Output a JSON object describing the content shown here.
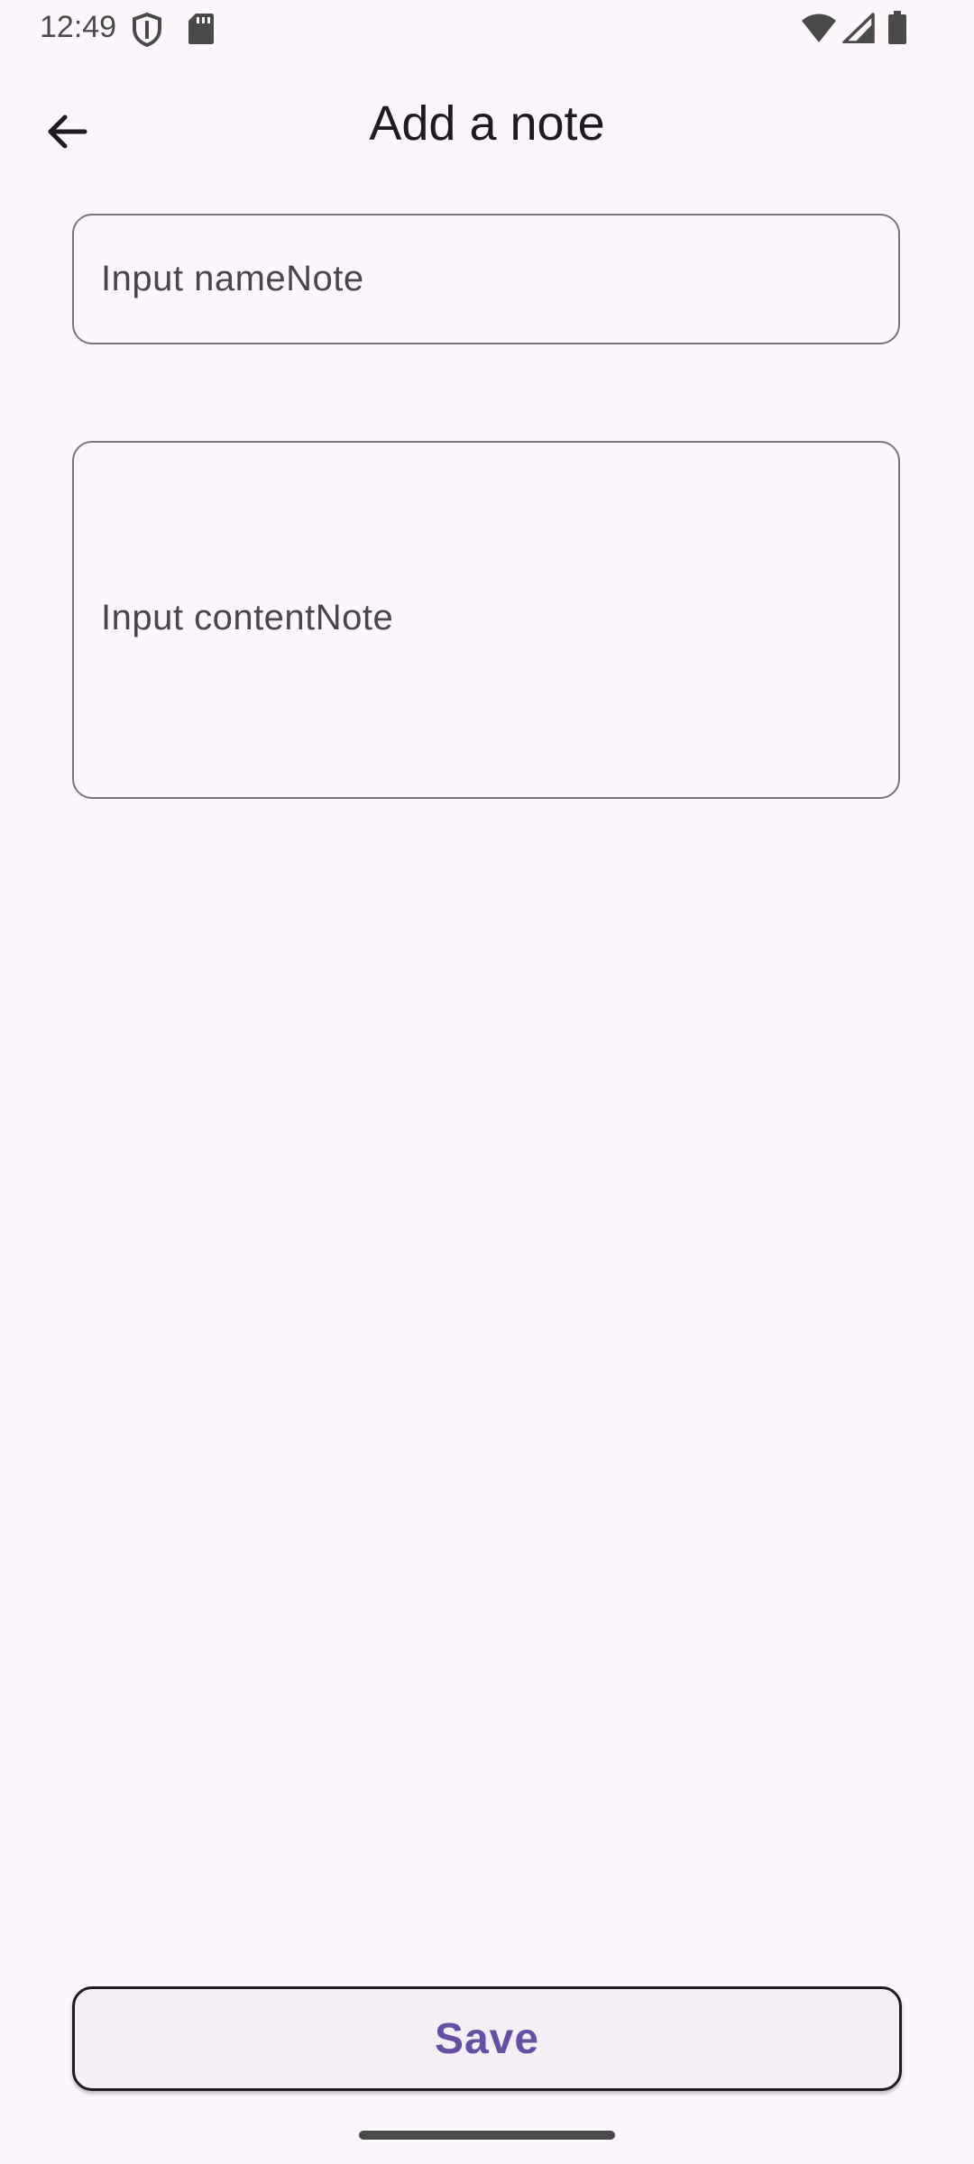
{
  "status_bar": {
    "time": "12:49",
    "icons": [
      "shield-icon",
      "sd-card-icon",
      "wifi-icon",
      "signal-icon",
      "battery-icon"
    ]
  },
  "app_bar": {
    "title": "Add a note",
    "back_icon": "arrow-back-icon"
  },
  "form": {
    "name_placeholder": "Input nameNote",
    "content_placeholder": "Input contentNote"
  },
  "actions": {
    "save_label": "Save"
  },
  "colors": {
    "background": "#fdf7fd",
    "accent": "#6750a4",
    "outline": "#79747e",
    "button_background": "#f4eff4"
  }
}
